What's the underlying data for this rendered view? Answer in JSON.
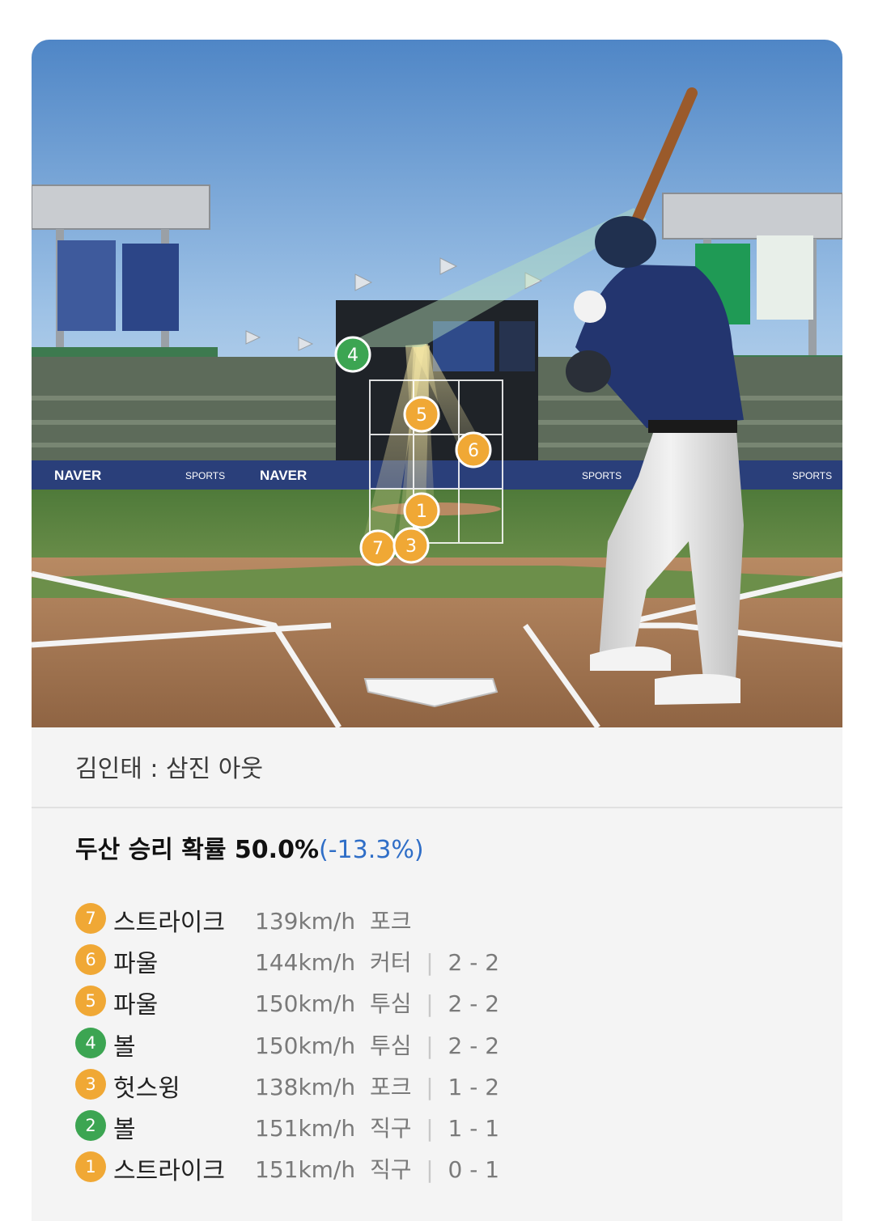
{
  "image": {
    "scene_semantic": "baseball-batter-stadium-illustration",
    "pitch_markers": [
      {
        "num": "4",
        "color": "#3ca552"
      },
      {
        "num": "5",
        "color": "#f0a835"
      },
      {
        "num": "6",
        "color": "#f0a835"
      },
      {
        "num": "1",
        "color": "#f0a835"
      },
      {
        "num": "7",
        "color": "#f0a835"
      },
      {
        "num": "3",
        "color": "#f0a835"
      }
    ],
    "ad_text": {
      "naver": "NAVER",
      "sports": "SPORTS"
    }
  },
  "caption": "김인태 : 삼진 아웃",
  "win_probability": {
    "label": "두산 승리 확률 50.0%",
    "delta": "(-13.3%)"
  },
  "colors": {
    "strike_badge": "#f0a835",
    "ball_badge": "#3ca552",
    "delta_text": "#2f6ec7"
  },
  "pitches": [
    {
      "num": "7",
      "result": "스트라이크",
      "speed": "139km/h",
      "type": "포크",
      "count": ""
    },
    {
      "num": "6",
      "result": "파울",
      "speed": "144km/h",
      "type": "커터",
      "count": "2 - 2"
    },
    {
      "num": "5",
      "result": "파울",
      "speed": "150km/h",
      "type": "투심",
      "count": "2 - 2"
    },
    {
      "num": "4",
      "result": "볼",
      "speed": "150km/h",
      "type": "투심",
      "count": "2 - 2"
    },
    {
      "num": "3",
      "result": "헛스윙",
      "speed": "138km/h",
      "type": "포크",
      "count": "1 - 2"
    },
    {
      "num": "2",
      "result": "볼",
      "speed": "151km/h",
      "type": "직구",
      "count": "1 - 1"
    },
    {
      "num": "1",
      "result": "스트라이크",
      "speed": "151km/h",
      "type": "직구",
      "count": "0 - 1"
    }
  ]
}
